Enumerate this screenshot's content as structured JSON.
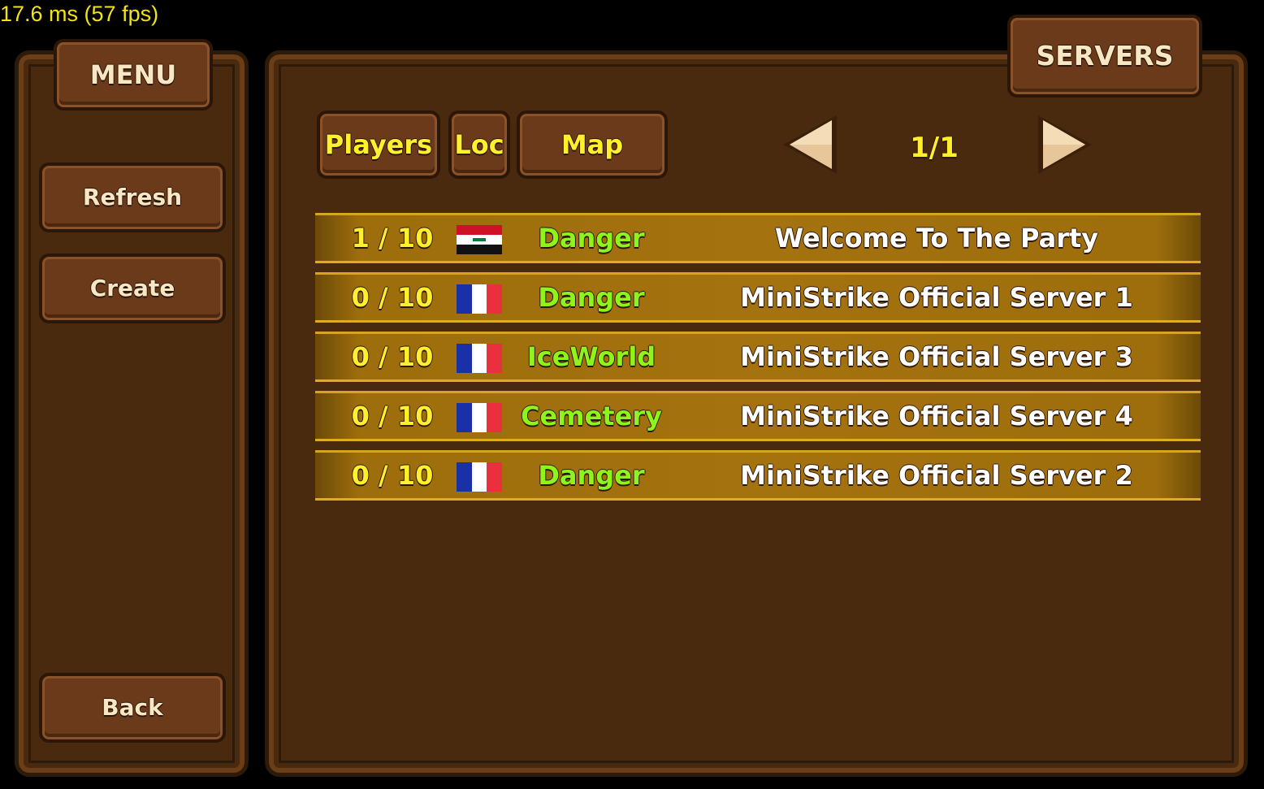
{
  "fps_text": "17.6 ms (57 fps)",
  "menu": {
    "title": "MENU",
    "refresh_label": "Refresh",
    "create_label": "Create",
    "back_label": "Back"
  },
  "servers_title": "SERVERS",
  "sort_tabs": {
    "players": "Players",
    "loc": "Loc",
    "map": "Map"
  },
  "pagination": {
    "text": "1/1"
  },
  "servers": [
    {
      "players": "1 / 10",
      "flag": "iraq-flag",
      "map": "Danger",
      "name": "Welcome To The Party"
    },
    {
      "players": "0 / 10",
      "flag": "france-flag",
      "map": "Danger",
      "name": "MiniStrike Official Server 1"
    },
    {
      "players": "0 / 10",
      "flag": "france-flag",
      "map": "IceWorld",
      "name": "MiniStrike Official Server 3"
    },
    {
      "players": "0 / 10",
      "flag": "france-flag",
      "map": "Cemetery",
      "name": "MiniStrike Official Server 4"
    },
    {
      "players": "0 / 10",
      "flag": "france-flag",
      "map": "Danger",
      "name": "MiniStrike Official Server 2"
    }
  ],
  "colors": {
    "panel": "#4a2a0f",
    "row_gold": "#a4720f",
    "player_count": "#fff02e",
    "map_green": "#8ef51c",
    "server_name": "#ffffff"
  }
}
